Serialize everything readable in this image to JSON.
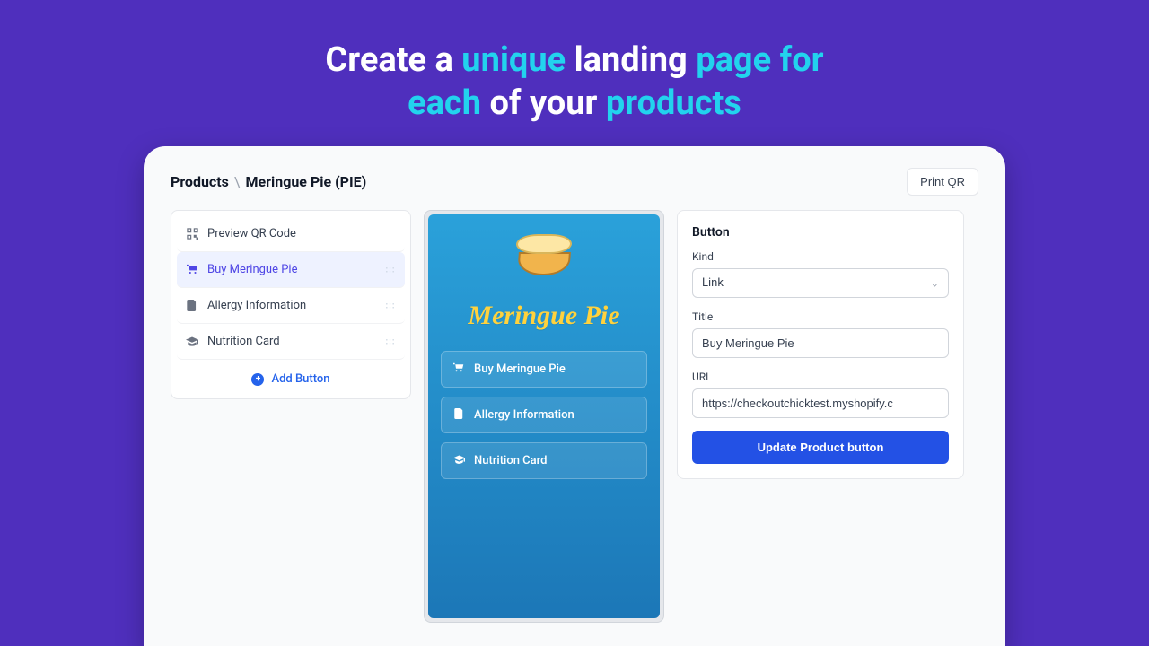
{
  "hero": {
    "parts": [
      "Create a ",
      "unique",
      " landing ",
      "page for",
      " ",
      "each",
      " of your ",
      "products"
    ]
  },
  "breadcrumb": {
    "root": "Products",
    "current": "Meringue Pie (PIE)"
  },
  "topbar": {
    "print_label": "Print QR"
  },
  "sidebar": {
    "items": [
      {
        "icon": "qr-icon",
        "label": "Preview QR Code",
        "draggable": false
      },
      {
        "icon": "cart-icon",
        "label": "Buy Meringue Pie",
        "draggable": true,
        "active": true
      },
      {
        "icon": "document-icon",
        "label": "Allergy Information",
        "draggable": true
      },
      {
        "icon": "graduation-icon",
        "label": "Nutrition Card",
        "draggable": true
      }
    ],
    "add_label": "Add Button"
  },
  "preview": {
    "product_name": "Meringue Pie",
    "buttons": [
      {
        "icon": "cart-icon",
        "label": "Buy Meringue Pie"
      },
      {
        "icon": "document-icon",
        "label": "Allergy Information"
      },
      {
        "icon": "graduation-icon",
        "label": "Nutrition Card"
      }
    ]
  },
  "form": {
    "section_title": "Button",
    "kind_label": "Kind",
    "kind_value": "Link",
    "title_label": "Title",
    "title_value": "Buy Meringue Pie",
    "url_label": "URL",
    "url_value": "https://checkoutchicktest.myshopify.c",
    "submit_label": "Update Product button"
  }
}
